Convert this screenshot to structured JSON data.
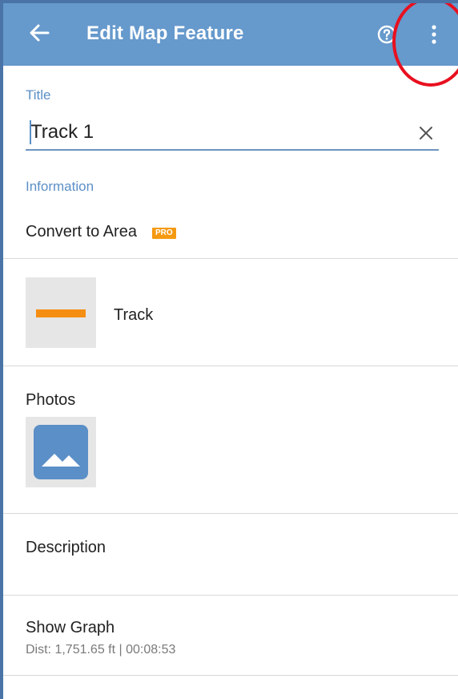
{
  "appbar": {
    "title": "Edit Map Feature",
    "back_icon": "arrow-left-icon",
    "help_icon": "help-circle-icon",
    "more_icon": "more-vert-icon",
    "background": "#6699cc"
  },
  "title_field": {
    "label": "Title",
    "value": "Track 1",
    "clear_icon": "close-icon"
  },
  "information": {
    "label": "Information",
    "convert_label": "Convert to Area",
    "pro_badge": "PRO"
  },
  "style": {
    "label": "Track",
    "color": "#f58f13"
  },
  "photos": {
    "label": "Photos",
    "icon": "image-icon"
  },
  "description": {
    "label": "Description"
  },
  "graph": {
    "label": "Show Graph",
    "stats": "Dist: 1,751.65 ft | 00:08:53"
  },
  "annotation": {
    "color": "#e8101f"
  }
}
